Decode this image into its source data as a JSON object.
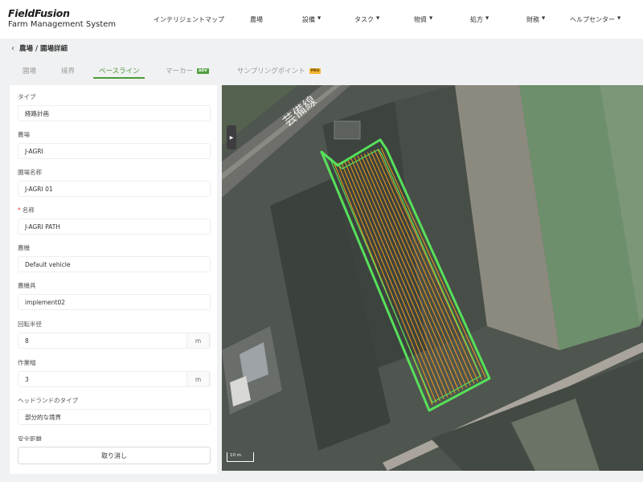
{
  "header": {
    "brand": "FieldFusion",
    "subtitle": "Farm Management System",
    "nav": [
      {
        "label": "インテリジェントマップ",
        "dropdown": false
      },
      {
        "label": "農場",
        "dropdown": false
      },
      {
        "label": "設備",
        "dropdown": true
      },
      {
        "label": "タスク",
        "dropdown": true
      },
      {
        "label": "物資",
        "dropdown": true
      },
      {
        "label": "処方",
        "dropdown": true
      },
      {
        "label": "財務",
        "dropdown": true
      },
      {
        "label": "ヘルプセンター",
        "dropdown": true
      }
    ]
  },
  "breadcrumb": {
    "back_icon": "chevron-left-icon",
    "text": "農場 / 圃場詳細"
  },
  "tabs": [
    {
      "label": "圃場",
      "active": false,
      "badge": ""
    },
    {
      "label": "境界",
      "active": false,
      "badge": ""
    },
    {
      "label": "ベースライン",
      "active": true,
      "badge": ""
    },
    {
      "label": "マーカー",
      "active": false,
      "badge": "ADV"
    },
    {
      "label": "サンプリングポイント",
      "active": false,
      "badge": "PRO"
    }
  ],
  "form": {
    "fields": [
      {
        "label": "タイプ",
        "value": "経路計画",
        "unit": "",
        "required": false
      },
      {
        "label": "農場",
        "value": "J-AGRI",
        "unit": "",
        "required": false
      },
      {
        "label": "圃場名称",
        "value": "J-AGRI 01",
        "unit": "",
        "required": false
      },
      {
        "label": "名称",
        "value": "J-AGRI PATH",
        "unit": "",
        "required": true
      },
      {
        "label": "農機",
        "value": "Default vehicle",
        "unit": "",
        "required": false
      },
      {
        "label": "農機具",
        "value": "implement02",
        "unit": "",
        "required": false
      },
      {
        "label": "回転半径",
        "value": "8",
        "unit": "m",
        "required": false
      },
      {
        "label": "作業幅",
        "value": "3",
        "unit": "m",
        "required": false
      },
      {
        "label": "ヘッドランドのタイプ",
        "value": "部分的な境界",
        "unit": "",
        "required": false
      },
      {
        "label": "安全距離",
        "value": "",
        "unit": "",
        "required": false
      }
    ],
    "cancel_label": "取り消し"
  },
  "map": {
    "road_label": "芸備線",
    "scale_label": "10 m",
    "collapse_icon": "caret-right-icon",
    "boundary_color": "#57e05a",
    "path_color": "#f29d1a"
  },
  "colors": {
    "accent": "#4a9a3a"
  }
}
